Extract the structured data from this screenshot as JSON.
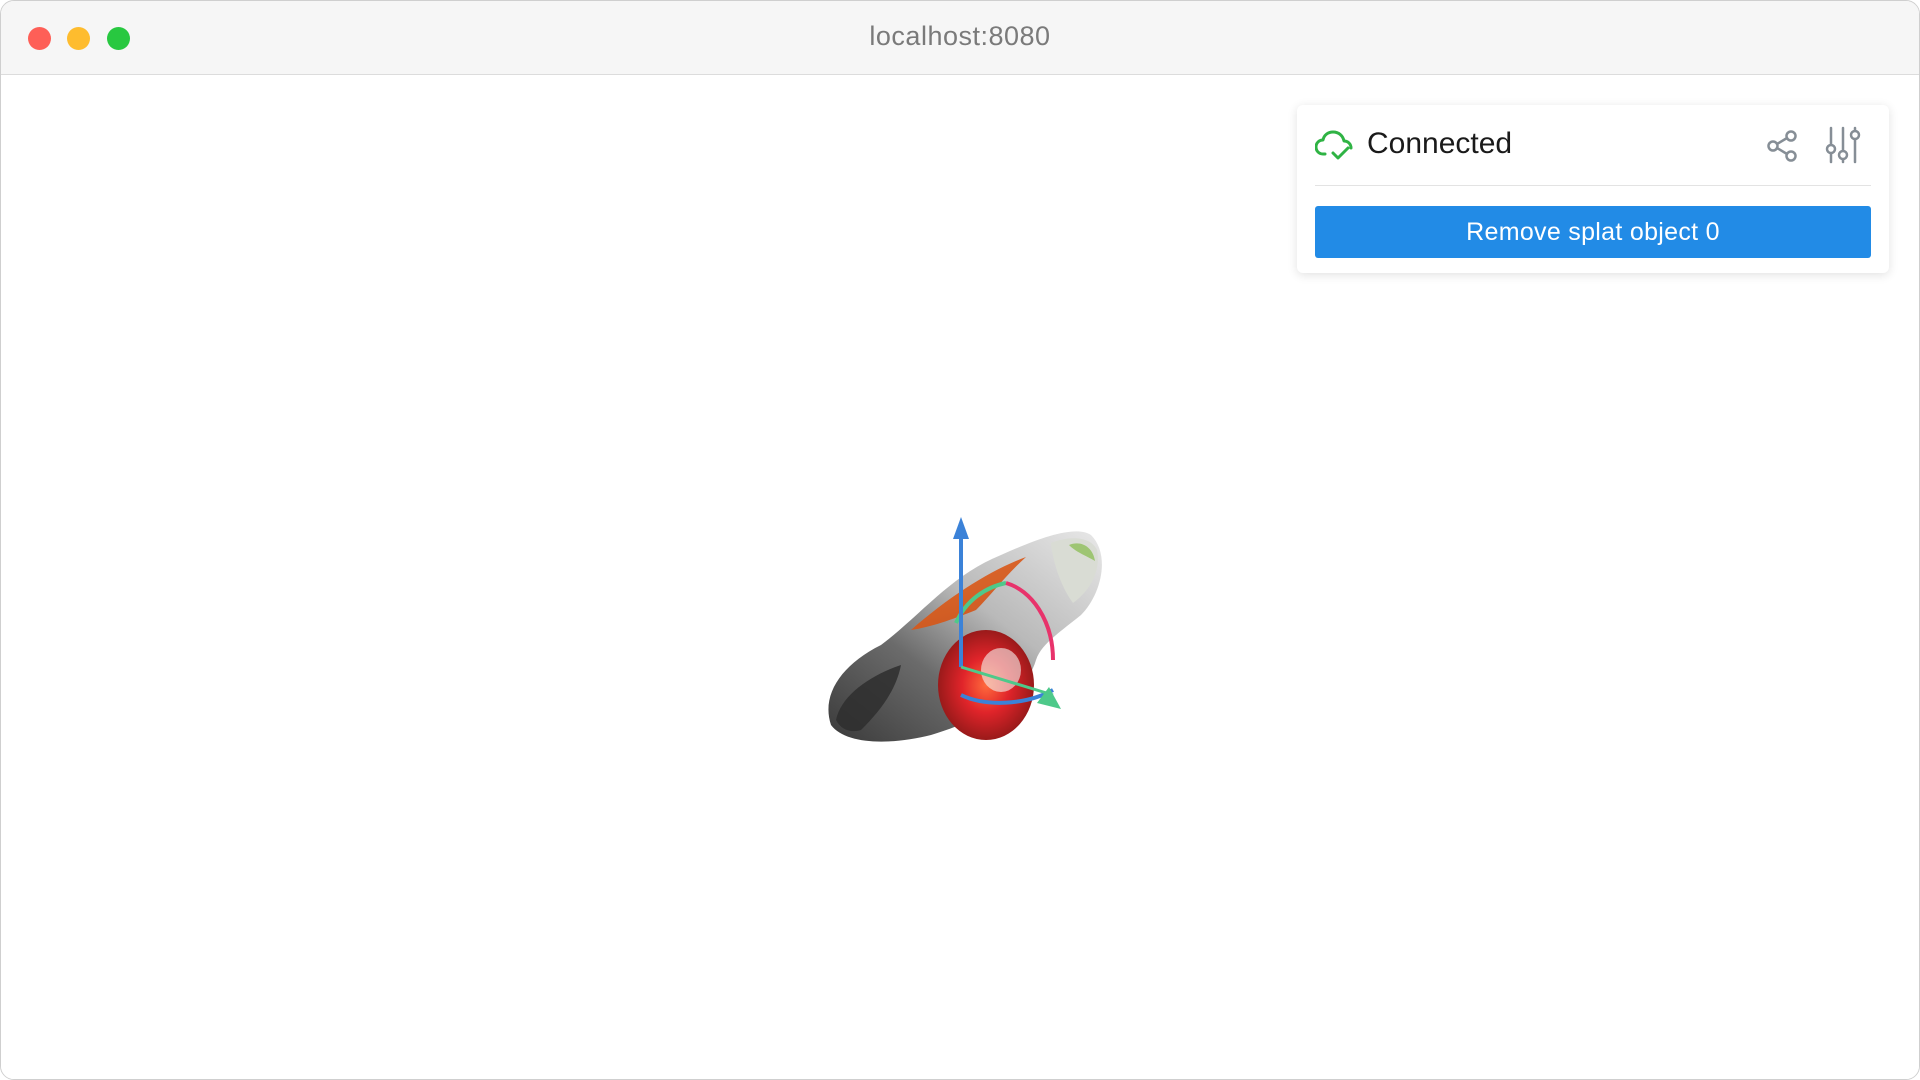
{
  "window": {
    "title": "localhost:8080"
  },
  "panel": {
    "status_text": "Connected",
    "status_icon": "cloud-check-icon",
    "share_icon": "share-icon",
    "settings_icon": "sliders-icon",
    "remove_button_label": "Remove splat object 0"
  },
  "colors": {
    "status_green": "#2fb344",
    "button_blue": "#228be6",
    "icon_gray": "#868e96",
    "gizmo_x": "#e8336b",
    "gizmo_y": "#4ec98a",
    "gizmo_z": "#3b82d8"
  }
}
